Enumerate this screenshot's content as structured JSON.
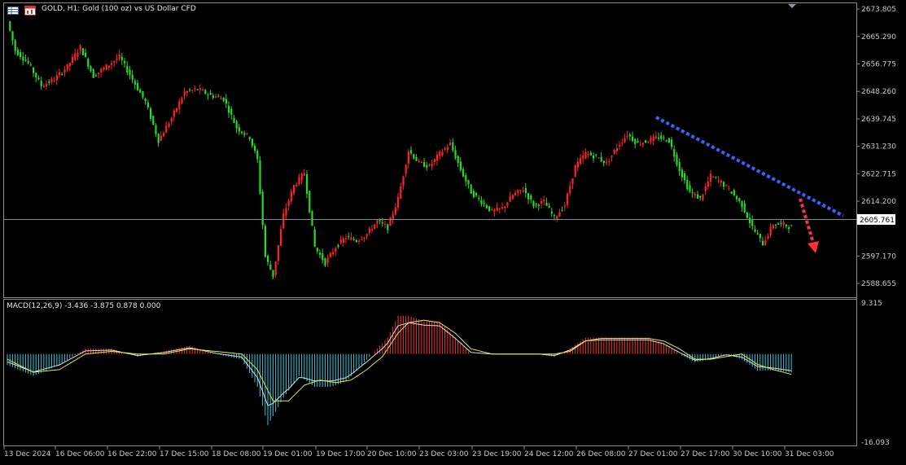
{
  "header": {
    "title": "GOLD, H1:  Gold (100 oz) vs US Dollar CFD",
    "grid_icon": "table-grid-icon",
    "chart_icon": "window-chart-icon"
  },
  "price_panel": {
    "y_ticks": [
      "2673.805",
      "2665.290",
      "2656.775",
      "2648.260",
      "2639.745",
      "2631.230",
      "2622.715",
      "2614.200",
      "2605.761",
      "2597.170",
      "2588.655"
    ],
    "current_price": "2605.761",
    "ylim": [
      2584.4,
      2675.6
    ]
  },
  "macd_panel": {
    "label": "MACD(12,26,9) -3.436 -3.875 0.878 0.000",
    "y_top_label": "9.315",
    "y_bottom_label": "-16.093"
  },
  "x_labels": [
    "13 Dec 2024",
    "16 Dec 06:00",
    "16 Dec 22:00",
    "17 Dec 15:00",
    "18 Dec 08:00",
    "19 Dec 01:00",
    "19 Dec 17:00",
    "20 Dec 10:00",
    "23 Dec 03:00",
    "23 Dec 19:00",
    "24 Dec 12:00",
    "26 Dec 08:00",
    "27 Dec 01:00",
    "27 Dec 17:00",
    "30 Dec 10:00",
    "31 Dec 03:00"
  ],
  "colors": {
    "bull": "#ff2222",
    "bear": "#22dd22",
    "hist_pos": "#ee3333",
    "hist_neg": "#33c6dd",
    "signal": "#e6e64a",
    "macd_line": "#dddddd",
    "trend_line": "#3366ff",
    "arrow": "#ff3333"
  },
  "chart_data": {
    "type": "candlestick",
    "title": "GOLD, H1:  Gold (100 oz) vs US Dollar CFD",
    "ylim": [
      2584.4,
      2675.6
    ],
    "close_path_keypoints": [
      [
        0,
        2670
      ],
      [
        3,
        2661
      ],
      [
        8,
        2657
      ],
      [
        13,
        2650
      ],
      [
        18,
        2652
      ],
      [
        23,
        2656
      ],
      [
        28,
        2662
      ],
      [
        33,
        2653
      ],
      [
        38,
        2656
      ],
      [
        43,
        2659
      ],
      [
        48,
        2652
      ],
      [
        53,
        2645
      ],
      [
        58,
        2633
      ],
      [
        63,
        2640
      ],
      [
        68,
        2648
      ],
      [
        73,
        2649
      ],
      [
        78,
        2647
      ],
      [
        83,
        2646
      ],
      [
        88,
        2637
      ],
      [
        93,
        2634
      ],
      [
        96,
        2627
      ],
      [
        99,
        2597
      ],
      [
        102,
        2591
      ],
      [
        106,
        2610
      ],
      [
        110,
        2619
      ],
      [
        114,
        2623
      ],
      [
        118,
        2600
      ],
      [
        122,
        2595
      ],
      [
        126,
        2600
      ],
      [
        130,
        2603
      ],
      [
        134,
        2602
      ],
      [
        138,
        2604
      ],
      [
        142,
        2608
      ],
      [
        146,
        2606
      ],
      [
        150,
        2615
      ],
      [
        154,
        2630
      ],
      [
        158,
        2626
      ],
      [
        162,
        2625
      ],
      [
        166,
        2629
      ],
      [
        170,
        2632
      ],
      [
        174,
        2624
      ],
      [
        178,
        2617
      ],
      [
        182,
        2614
      ],
      [
        186,
        2611
      ],
      [
        190,
        2612
      ],
      [
        194,
        2616
      ],
      [
        198,
        2618
      ],
      [
        202,
        2613
      ],
      [
        206,
        2614
      ],
      [
        210,
        2609
      ],
      [
        214,
        2613
      ],
      [
        218,
        2625
      ],
      [
        222,
        2629
      ],
      [
        226,
        2628
      ],
      [
        230,
        2626
      ],
      [
        234,
        2631
      ],
      [
        238,
        2635
      ],
      [
        242,
        2632
      ],
      [
        246,
        2633
      ],
      [
        250,
        2634
      ],
      [
        254,
        2633
      ],
      [
        258,
        2624
      ],
      [
        262,
        2617
      ],
      [
        266,
        2615
      ],
      [
        270,
        2622
      ],
      [
        274,
        2620
      ],
      [
        278,
        2617
      ],
      [
        282,
        2613
      ],
      [
        286,
        2606
      ],
      [
        290,
        2601
      ],
      [
        294,
        2607
      ],
      [
        298,
        2607
      ],
      [
        301,
        2606
      ]
    ],
    "macd_keypoints": [
      [
        0,
        -2
      ],
      [
        10,
        -4
      ],
      [
        20,
        -2
      ],
      [
        30,
        1
      ],
      [
        40,
        1
      ],
      [
        50,
        -0.5
      ],
      [
        60,
        0.5
      ],
      [
        70,
        1.5
      ],
      [
        80,
        0
      ],
      [
        90,
        -1
      ],
      [
        96,
        -6
      ],
      [
        100,
        -13
      ],
      [
        106,
        -8
      ],
      [
        112,
        -4
      ],
      [
        118,
        -6
      ],
      [
        124,
        -6
      ],
      [
        130,
        -5
      ],
      [
        136,
        -2
      ],
      [
        142,
        1
      ],
      [
        146,
        3
      ],
      [
        150,
        7
      ],
      [
        154,
        7
      ],
      [
        160,
        6
      ],
      [
        166,
        6
      ],
      [
        172,
        3
      ],
      [
        178,
        0
      ],
      [
        186,
        0
      ],
      [
        192,
        0
      ],
      [
        198,
        0
      ],
      [
        204,
        0
      ],
      [
        210,
        -0.5
      ],
      [
        216,
        1
      ],
      [
        222,
        3
      ],
      [
        228,
        3
      ],
      [
        234,
        3
      ],
      [
        240,
        3
      ],
      [
        246,
        3
      ],
      [
        252,
        2
      ],
      [
        258,
        0
      ],
      [
        264,
        -1.5
      ],
      [
        270,
        -1
      ],
      [
        276,
        0
      ],
      [
        282,
        -1
      ],
      [
        288,
        -3
      ],
      [
        294,
        -3
      ],
      [
        301,
        -3.4
      ]
    ],
    "signal_keypoints": [
      [
        0,
        -1
      ],
      [
        10,
        -3.5
      ],
      [
        20,
        -3
      ],
      [
        30,
        0
      ],
      [
        40,
        0.5
      ],
      [
        50,
        0
      ],
      [
        60,
        0
      ],
      [
        70,
        1
      ],
      [
        80,
        0.5
      ],
      [
        90,
        0
      ],
      [
        96,
        -3
      ],
      [
        102,
        -9
      ],
      [
        108,
        -9
      ],
      [
        114,
        -6
      ],
      [
        120,
        -5
      ],
      [
        126,
        -5.5
      ],
      [
        132,
        -5
      ],
      [
        138,
        -3
      ],
      [
        144,
        -0.5
      ],
      [
        150,
        4
      ],
      [
        154,
        6
      ],
      [
        160,
        6.5
      ],
      [
        166,
        6
      ],
      [
        172,
        4
      ],
      [
        178,
        1
      ],
      [
        186,
        0
      ],
      [
        192,
        0
      ],
      [
        198,
        0
      ],
      [
        204,
        0
      ],
      [
        210,
        0
      ],
      [
        216,
        0.5
      ],
      [
        222,
        2.5
      ],
      [
        228,
        3
      ],
      [
        234,
        3
      ],
      [
        240,
        3
      ],
      [
        246,
        3
      ],
      [
        252,
        2.5
      ],
      [
        258,
        1
      ],
      [
        264,
        -1
      ],
      [
        270,
        -1
      ],
      [
        276,
        -0.5
      ],
      [
        282,
        0
      ],
      [
        288,
        -2
      ],
      [
        294,
        -3
      ],
      [
        301,
        -3.9
      ]
    ],
    "x_tick_labels": [
      "13 Dec 2024",
      "16 Dec 06:00",
      "16 Dec 22:00",
      "17 Dec 15:00",
      "18 Dec 08:00",
      "19 Dec 01:00",
      "19 Dec 17:00",
      "20 Dec 10:00",
      "23 Dec 03:00",
      "23 Dec 19:00",
      "24 Dec 12:00",
      "26 Dec 08:00",
      "27 Dec 01:00",
      "27 Dec 17:00",
      "30 Dec 10:00",
      "31 Dec 03:00"
    ],
    "macd_ylim": [
      -16.093,
      9.315
    ]
  }
}
